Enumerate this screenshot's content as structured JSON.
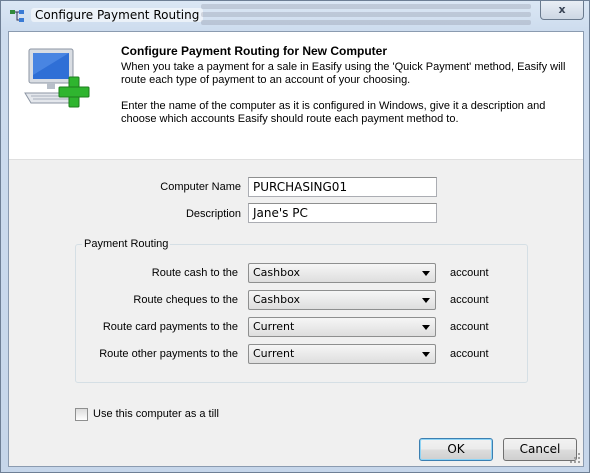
{
  "window": {
    "title": "Configure Payment Routing",
    "close_glyph": "x"
  },
  "header": {
    "icon": "computer-add-icon",
    "title": "Configure Payment Routing for New Computer",
    "paragraph1": "When you take a payment for a sale in Easify using the 'Quick Payment' method, Easify will route each type of payment to an account of your choosing.",
    "paragraph2": "Enter the name of the computer as it is configured in Windows, give it a description and choose which accounts Easify should route each payment method to."
  },
  "form": {
    "computer_name_label": "Computer Name",
    "computer_name_value": "PURCHASING01",
    "description_label": "Description",
    "description_value": "Jane's PC"
  },
  "routing": {
    "group_label": "Payment Routing",
    "account_suffix": "account",
    "rows": [
      {
        "label": "Route cash to the",
        "value": "Cashbox"
      },
      {
        "label": "Route cheques to the",
        "value": "Cashbox"
      },
      {
        "label": "Route card payments to the",
        "value": "Current"
      },
      {
        "label": "Route other payments to the",
        "value": "Current"
      }
    ]
  },
  "till": {
    "label": "Use this computer as a till",
    "checked": false
  },
  "buttons": {
    "ok": "OK",
    "cancel": "Cancel"
  },
  "colors": {
    "accent_green": "#2fb52f",
    "monitor_blue": "#2f6fd6"
  }
}
